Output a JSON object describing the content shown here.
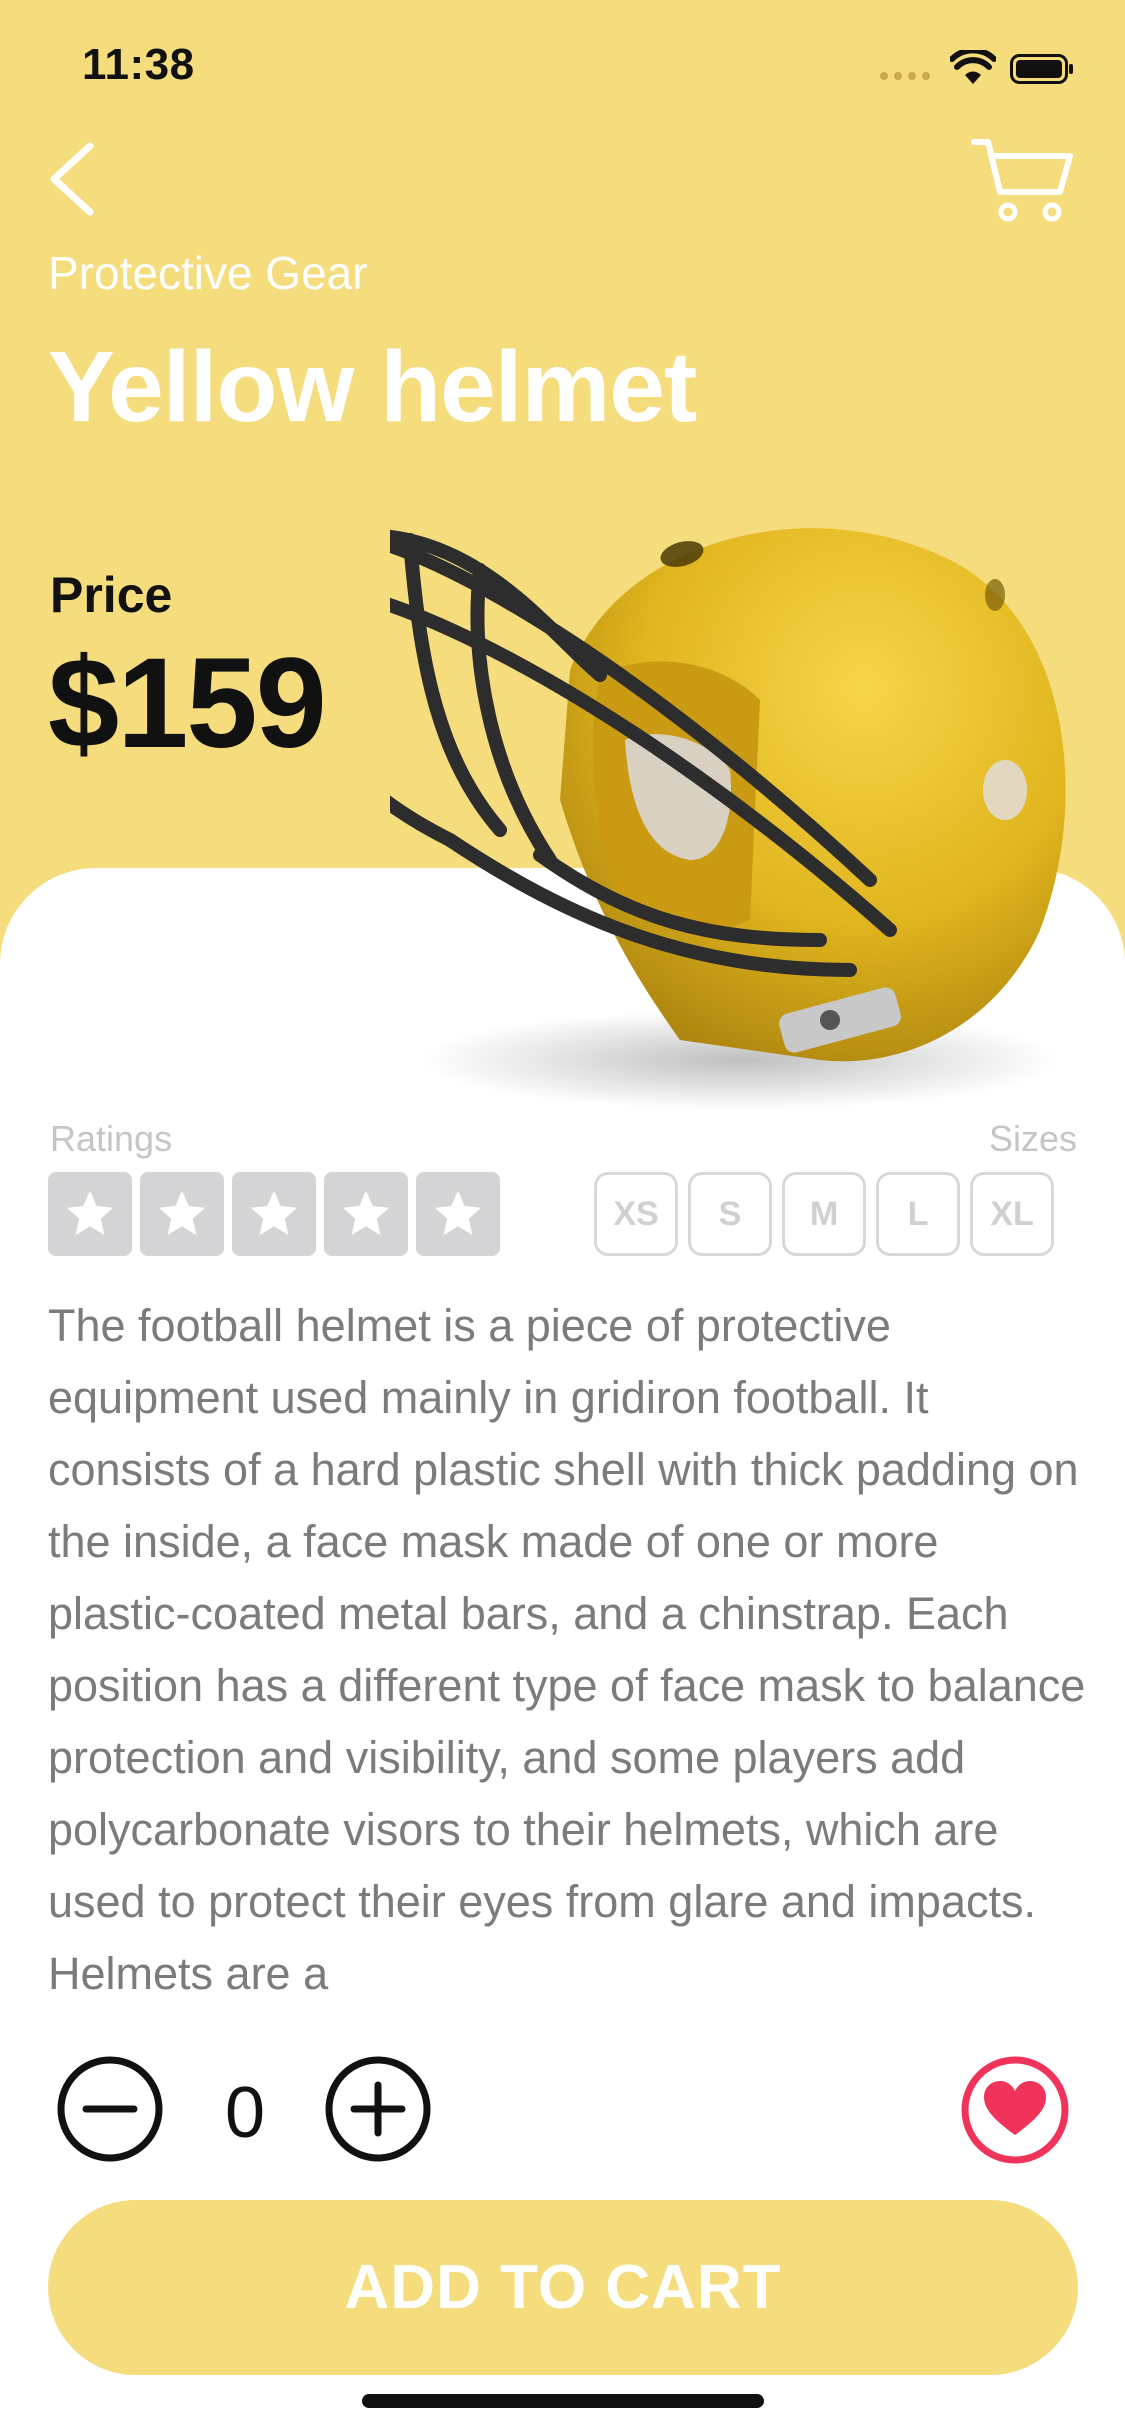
{
  "status_bar": {
    "time": "11:38"
  },
  "header": {
    "category": "Protective Gear",
    "title": "Yellow helmet"
  },
  "price": {
    "label": "Price",
    "value": "$159"
  },
  "ratings": {
    "label": "Ratings",
    "max_stars": 5
  },
  "sizes": {
    "label": "Sizes",
    "options": [
      "XS",
      "S",
      "M",
      "L",
      "XL"
    ]
  },
  "description": "The football helmet is a piece of protective equipment used mainly in gridiron football. It consists of a hard plastic shell with thick padding on the inside, a face mask made of one or more plastic-coated metal bars, and a chinstrap. Each position has a different type of face mask to balance protection and visibility, and some players add polycarbonate visors to their helmets, which are used to protect their eyes from glare and impacts. Helmets are a",
  "quantity": {
    "value": "0"
  },
  "cta": {
    "label": "ADD TO CART"
  },
  "icons": {
    "back": "chevron-left-icon",
    "cart": "shopping-cart-icon",
    "minus": "minus-circle-icon",
    "plus": "plus-circle-icon",
    "favorite": "heart-icon",
    "star": "star-icon"
  },
  "colors": {
    "accent": "#f5dc7c",
    "favorite": "#f0335a",
    "text_muted": "#7b7b7b",
    "inactive": "#d4d4d6"
  }
}
